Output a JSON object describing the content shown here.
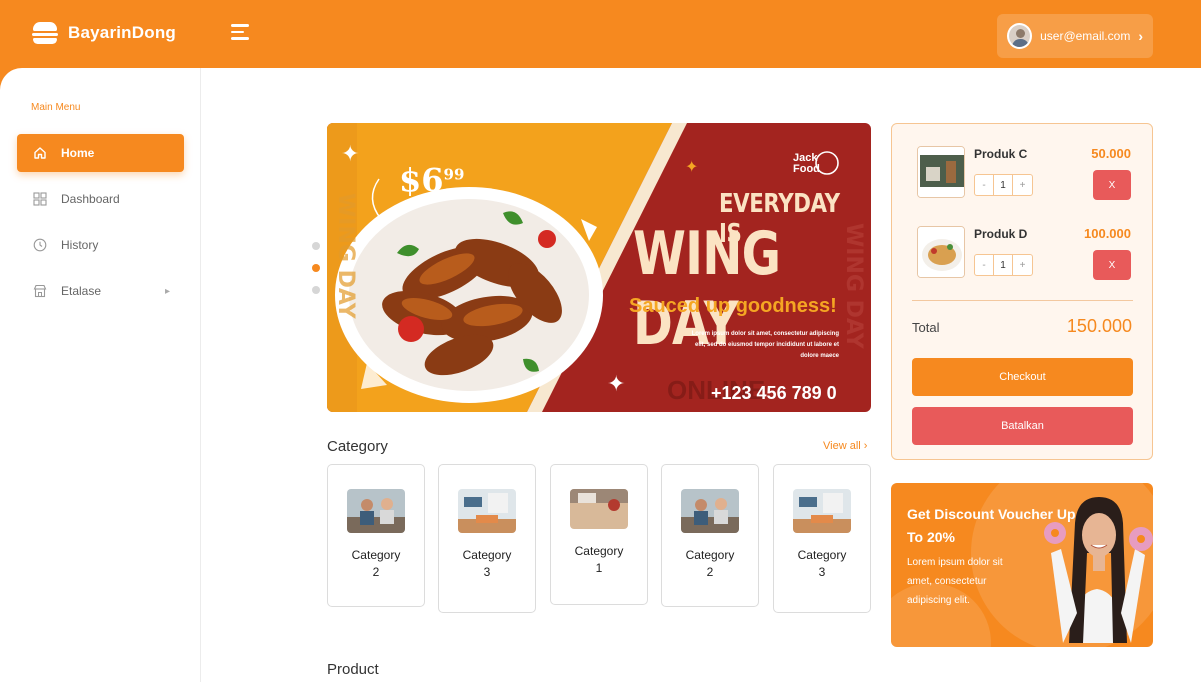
{
  "app": {
    "brand": "BayarinDong"
  },
  "header": {
    "user_email": "user@email.com"
  },
  "sidebar": {
    "section_label": "Main Menu",
    "items": [
      {
        "label": "Home",
        "icon": "home-icon",
        "active": true
      },
      {
        "label": "Dashboard",
        "icon": "grid-icon",
        "active": false
      },
      {
        "label": "History",
        "icon": "clock-icon",
        "active": false
      },
      {
        "label": "Etalase",
        "icon": "store-icon",
        "active": false,
        "has_submenu": true
      }
    ]
  },
  "banner": {
    "price": "$6",
    "price_cents": "99",
    "brand": "Jack Food",
    "line1": "EVERYDAY IS",
    "line2": "WING DAY",
    "line3": "Sauced up goodness!",
    "lorem": "Lorem ipsum dolor sit amet, consectetur adipiscing elit, sed do eiusmod tempor incididunt ut labore et dolore maece",
    "phone": "+123 456 789 0",
    "online": "ONLINE",
    "slides": 3,
    "active_slide": 2
  },
  "category_section": {
    "title": "Category",
    "view_all": "View all",
    "cards": [
      {
        "name": "Category",
        "number": "2"
      },
      {
        "name": "Category",
        "number": "3"
      },
      {
        "name": "Category",
        "number": "1"
      },
      {
        "name": "Category",
        "number": "2"
      },
      {
        "name": "Category",
        "number": "3"
      }
    ]
  },
  "product_section": {
    "title": "Product"
  },
  "cart": {
    "items": [
      {
        "name": "Produk C",
        "price": "50.000",
        "qty": "1",
        "minus": "-",
        "plus": "+",
        "remove": "X"
      },
      {
        "name": "Produk D",
        "price": "100.000",
        "qty": "1",
        "minus": "-",
        "plus": "+",
        "remove": "X"
      }
    ],
    "total_label": "Total",
    "total_value": "150.000",
    "checkout_label": "Checkout",
    "cancel_label": "Batalkan"
  },
  "promo": {
    "title": "Get Discount Voucher Up To 20%",
    "text": "Lorem ipsum dolor sit amet, consectetur adipiscing elit."
  },
  "colors": {
    "accent": "#f6891f",
    "danger": "#e85a5a",
    "banner_red": "#a3241f"
  }
}
